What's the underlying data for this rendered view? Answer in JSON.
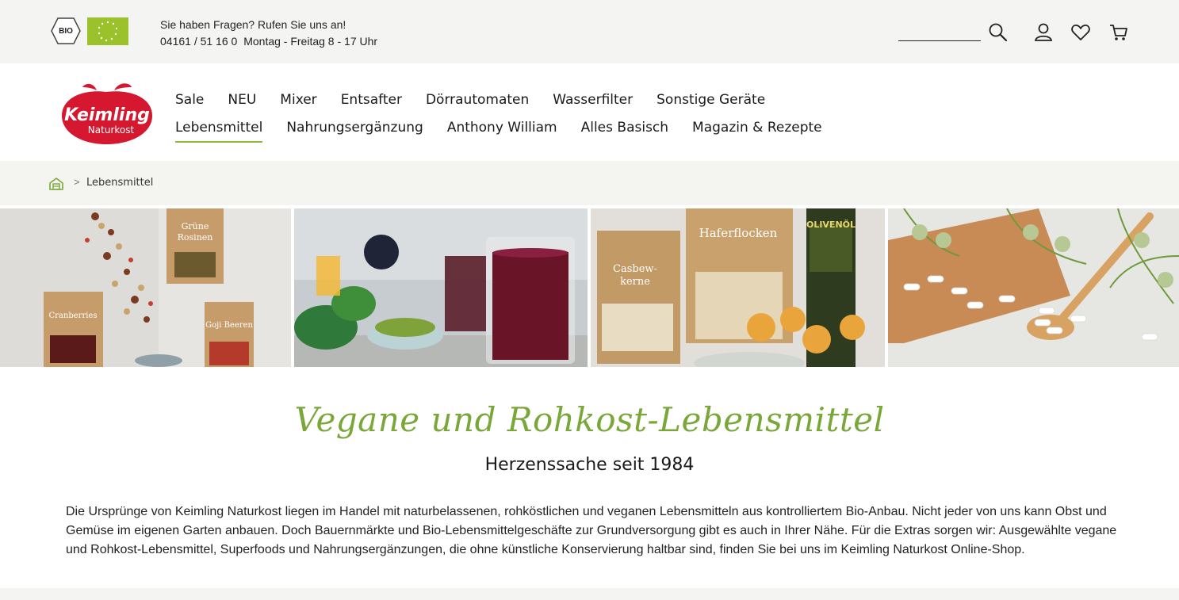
{
  "topbar": {
    "contact_line1": "Sie haben Fragen? Rufen Sie uns an!",
    "contact_phone": "04161 / 51 16 0",
    "contact_hours": "Montag - Freitag 8 - 17 Uhr",
    "search_placeholder": "",
    "bio_badge": "BIO"
  },
  "logo": {
    "brand": "Keimling",
    "sub": "Naturkost"
  },
  "nav": {
    "row1": [
      "Sale",
      "NEU",
      "Mixer",
      "Entsafter",
      "Dörrautomaten",
      "Wasserfilter",
      "Sonstige Geräte"
    ],
    "row2": [
      "Lebensmittel",
      "Nahrungsergänzung",
      "Anthony William",
      "Alles Basisch",
      "Magazin & Rezepte"
    ],
    "active": "Lebensmittel"
  },
  "breadcrumb": {
    "separator": ">",
    "current": "Lebensmittel"
  },
  "hero": {
    "img1_labels": [
      "Grüne",
      "Rosinen",
      "Cranberries",
      "Goji Beeren"
    ],
    "img3_labels": [
      "Casbew-",
      "kerne",
      "Haferflocken",
      "OLIVENÖL"
    ]
  },
  "content": {
    "title": "Vegane und Rohkost-Lebensmittel",
    "subtitle": "Herzenssache seit 1984",
    "intro": "Die Ursprünge von Keimling Naturkost liegen im Handel mit naturbelassenen, rohköstlichen und veganen Lebensmitteln aus kontrolliertem Bio-Anbau. Nicht jeder von uns kann Obst und Gemüse im eigenen Garten anbauen. Doch Bauernmärkte und Bio-Lebensmittelgeschäfte zur Grundversorgung gibt es auch in Ihrer Nähe. Für die Extras sorgen wir: Ausgewählte vegane und Rohkost-Lebensmittel, Superfoods und Nahrungsergänzungen, die ohne künstliche Konservierung haltbar sind, finden Sie bei uns im Keimling Naturkost Online-Shop."
  },
  "colors": {
    "accent_green": "#8cb63c",
    "script_green": "#7aa73a",
    "brand_red": "#d5172f",
    "topbar_bg": "#f4f4f2"
  },
  "icons": [
    "bio-badge-icon",
    "eu-organic-leaf-icon",
    "search-icon",
    "user-icon",
    "heart-icon",
    "cart-icon",
    "home-icon"
  ]
}
